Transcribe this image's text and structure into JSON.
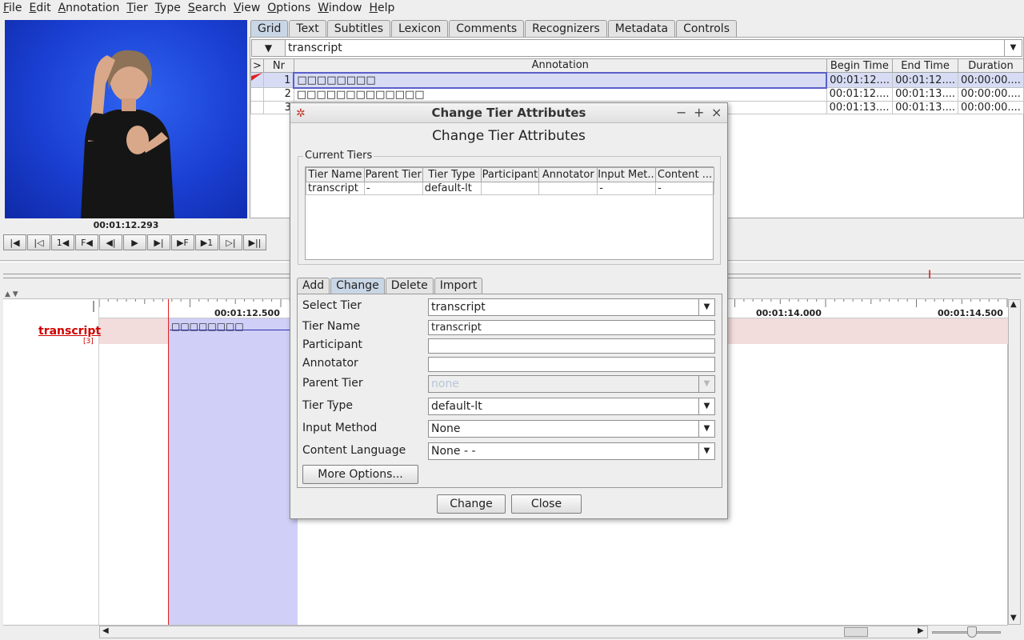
{
  "menu": [
    "File",
    "Edit",
    "Annotation",
    "Tier",
    "Type",
    "Search",
    "View",
    "Options",
    "Window",
    "Help"
  ],
  "media": {
    "time": "00:01:12.293"
  },
  "player_buttons": [
    "|◀",
    "|◁",
    "1◀",
    "F◀",
    "◀|",
    "▶",
    "▶|",
    "▶F",
    "▶1",
    "▷|",
    "▶||"
  ],
  "tabs": [
    "Grid",
    "Text",
    "Subtitles",
    "Lexicon",
    "Comments",
    "Recognizers",
    "Metadata",
    "Controls"
  ],
  "grid": {
    "tier": "transcript",
    "headers": {
      "marker": ">",
      "nr": "Nr",
      "annotation": "Annotation",
      "begin": "Begin Time",
      "end": "End Time",
      "duration": "Duration"
    },
    "rows": [
      {
        "nr": "1",
        "annotation": "□□□□□□□□",
        "begin": "00:01:12....",
        "end": "00:01:12....",
        "duration": "00:00:00...."
      },
      {
        "nr": "2",
        "annotation": "□□□□□□□□□□□□□",
        "begin": "00:01:12....",
        "end": "00:01:13....",
        "duration": "00:00:00...."
      },
      {
        "nr": "3",
        "annotation": "□□□□□□□□",
        "begin": "00:01:13....",
        "end": "00:01:13....",
        "duration": "00:00:00...."
      }
    ]
  },
  "timeline": {
    "ruler_labels": [
      "00:01:12.500",
      "00:01:14.000",
      "00:01:14.500"
    ],
    "tier_label": "transcript",
    "tier_count": "[3]",
    "annotation_text": "□□□□□□□□"
  },
  "dialog": {
    "title": "Change Tier Attributes",
    "heading": "Change Tier Attributes",
    "current_tiers_legend": "Current Tiers",
    "columns": [
      "Tier Name",
      "Parent Tier",
      "Tier Type",
      "Participant",
      "Annotator",
      "Input Met...",
      "Content ..."
    ],
    "row": [
      "transcript",
      "-",
      "default-lt",
      "",
      "",
      "-",
      "-"
    ],
    "tabs": [
      "Add",
      "Change",
      "Delete",
      "Import"
    ],
    "form": {
      "select_tier_label": "Select Tier",
      "select_tier_value": "transcript",
      "tier_name_label": "Tier Name",
      "tier_name_value": "transcript",
      "participant_label": "Participant",
      "participant_value": "",
      "annotator_label": "Annotator",
      "annotator_value": "",
      "parent_tier_label": "Parent Tier",
      "parent_tier_value": "none",
      "tier_type_label": "Tier Type",
      "tier_type_value": "default-lt",
      "input_method_label": "Input Method",
      "input_method_value": "None",
      "content_language_label": "Content Language",
      "content_language_value": "None -  -",
      "more_options": "More Options..."
    },
    "change_button": "Change",
    "close_button": "Close"
  }
}
